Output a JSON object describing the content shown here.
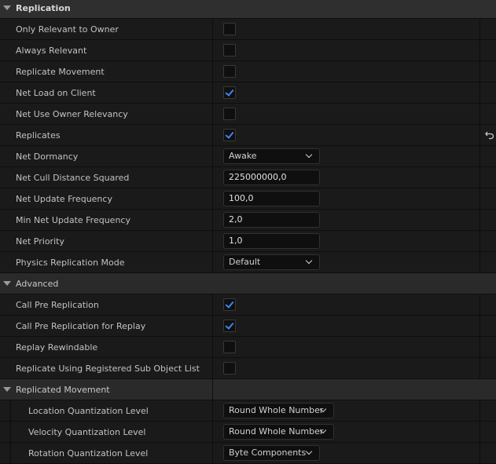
{
  "header": {
    "title": "Replication"
  },
  "rows": {
    "r0": {
      "label": "Only Relevant to Owner",
      "checked": false
    },
    "r1": {
      "label": "Always Relevant",
      "checked": false
    },
    "r2": {
      "label": "Replicate Movement",
      "checked": false
    },
    "r3": {
      "label": "Net Load on Client",
      "checked": true
    },
    "r4": {
      "label": "Net Use Owner Relevancy",
      "checked": false
    },
    "r5": {
      "label": "Replicates",
      "checked": true
    },
    "r6": {
      "label": "Net Dormancy",
      "value": "Awake"
    },
    "r7": {
      "label": "Net Cull Distance Squared",
      "value": "225000000,0"
    },
    "r8": {
      "label": "Net Update Frequency",
      "value": "100,0"
    },
    "r9": {
      "label": "Min Net Update Frequency",
      "value": "2,0"
    },
    "r10": {
      "label": "Net Priority",
      "value": "1,0"
    },
    "r11": {
      "label": "Physics Replication Mode",
      "value": "Default"
    }
  },
  "advanced": {
    "title": "Advanced",
    "r0": {
      "label": "Call Pre Replication",
      "checked": true
    },
    "r1": {
      "label": "Call Pre Replication for Replay",
      "checked": true
    },
    "r2": {
      "label": "Replay Rewindable",
      "checked": false
    },
    "r3": {
      "label": "Replicate Using Registered Sub Object List",
      "checked": false
    }
  },
  "replicated_movement": {
    "title": "Replicated Movement",
    "r0": {
      "label": "Location Quantization Level",
      "value": "Round Whole Number"
    },
    "r1": {
      "label": "Velocity Quantization Level",
      "value": "Round Whole Number"
    },
    "r2": {
      "label": "Rotation Quantization Level",
      "value": "Byte Components"
    }
  },
  "icons": {
    "reset": "reset-to-default-icon",
    "expand": "expand-arrow-icon",
    "dropdown": "chevron-down-icon"
  },
  "colors": {
    "accent": "#3f86f0",
    "background": "#1a1a1a",
    "header": "#2f2f2f"
  }
}
